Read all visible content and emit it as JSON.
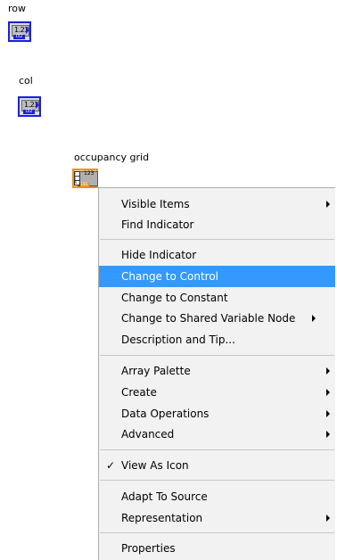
{
  "terminals": {
    "row": {
      "label": "row",
      "value_text": "1.23",
      "type_text": "I32"
    },
    "col": {
      "label": "col",
      "value_text": "1.23",
      "type_text": "I32"
    },
    "grid": {
      "label": "occupancy grid",
      "value_text": "123",
      "tag_text": "DBL",
      "index": [
        "i",
        "j",
        "k"
      ]
    }
  },
  "menu": {
    "highlighted_item": "Change to Control",
    "groups": [
      [
        {
          "label": "Visible Items",
          "submenu": true
        },
        {
          "label": "Find Indicator",
          "submenu": false
        }
      ],
      [
        {
          "label": "Hide Indicator",
          "submenu": false
        },
        {
          "label": "Change to Control",
          "submenu": false
        },
        {
          "label": "Change to Constant",
          "submenu": false
        },
        {
          "label": "Change to Shared Variable Node",
          "submenu": true
        },
        {
          "label": "Description and Tip...",
          "submenu": false
        }
      ],
      [
        {
          "label": "Array Palette",
          "submenu": true
        },
        {
          "label": "Create",
          "submenu": true
        },
        {
          "label": "Data Operations",
          "submenu": true
        },
        {
          "label": "Advanced",
          "submenu": true
        }
      ],
      [
        {
          "label": "View As Icon",
          "submenu": false,
          "checked": true,
          "check_glyph": "✓"
        }
      ],
      [
        {
          "label": "Adapt To Source",
          "submenu": false
        },
        {
          "label": "Representation",
          "submenu": true
        }
      ],
      [
        {
          "label": "Properties",
          "submenu": false
        }
      ]
    ]
  }
}
